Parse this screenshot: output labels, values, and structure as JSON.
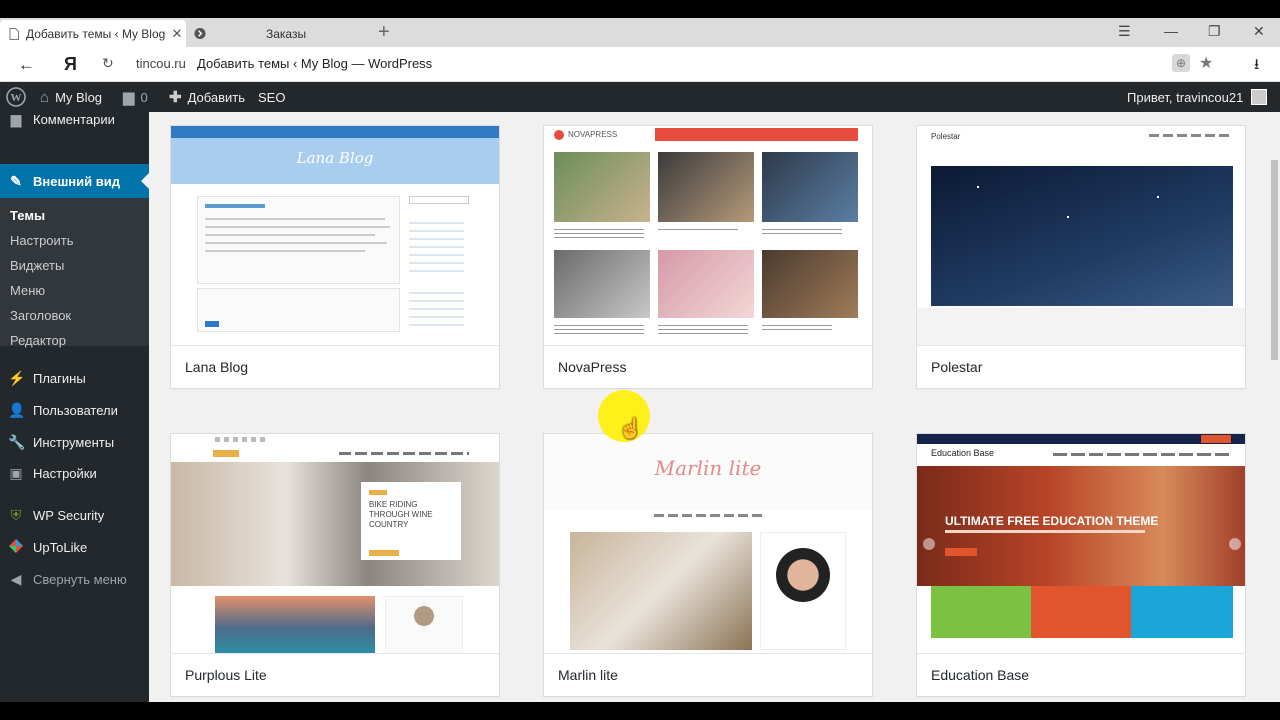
{
  "browser": {
    "tabs": [
      {
        "label": "Добавить темы ‹ My Blog",
        "icon": "page-icon",
        "active": true
      },
      {
        "label": "Заказы",
        "icon": "tab-icon",
        "active": false
      }
    ],
    "domain": "tincou.ru",
    "page_title": "Добавить темы ‹ My Blog — WordPress",
    "yandex_label": "Я"
  },
  "admin_bar": {
    "site_name": "My Blog",
    "comments_count": "0",
    "add_label": "Добавить",
    "seo_label": "SEO",
    "greeting": "Привет, travincou21"
  },
  "sidebar": {
    "items": [
      {
        "label": "Комментарии",
        "icon": "comment-icon"
      },
      {
        "label": "Внешний вид",
        "icon": "brush-icon"
      },
      {
        "label": "Плагины",
        "icon": "plugin-icon"
      },
      {
        "label": "Пользователи",
        "icon": "users-icon"
      },
      {
        "label": "Инструменты",
        "icon": "wrench-icon"
      },
      {
        "label": "Настройки",
        "icon": "settings-icon"
      },
      {
        "label": "WP Security",
        "icon": "shield-icon"
      },
      {
        "label": "UpToLike",
        "icon": "uptolike-icon"
      },
      {
        "label": "Свернуть меню",
        "icon": "collapse-icon"
      }
    ],
    "submenu": [
      "Темы",
      "Настроить",
      "Виджеты",
      "Меню",
      "Заголовок",
      "Редактор"
    ]
  },
  "themes": [
    {
      "name": "Lana Blog",
      "preview_title": "Lana Blog"
    },
    {
      "name": "NovaPress",
      "preview_title": "NOVAPRESS"
    },
    {
      "name": "Polestar",
      "preview_title": "Polestar"
    },
    {
      "name": "Purplous Lite",
      "preview_title": "BIKE RIDING THROUGH WINE COUNTRY"
    },
    {
      "name": "Marlin lite",
      "preview_title": "Marlin lite"
    },
    {
      "name": "Education Base",
      "preview_title": "ULTIMATE FREE EDUCATION THEME",
      "preview_brand": "Education Base"
    }
  ],
  "colors": {
    "wp_dark": "#23282d",
    "wp_blue": "#0073aa",
    "background": "#f1f1f1"
  }
}
